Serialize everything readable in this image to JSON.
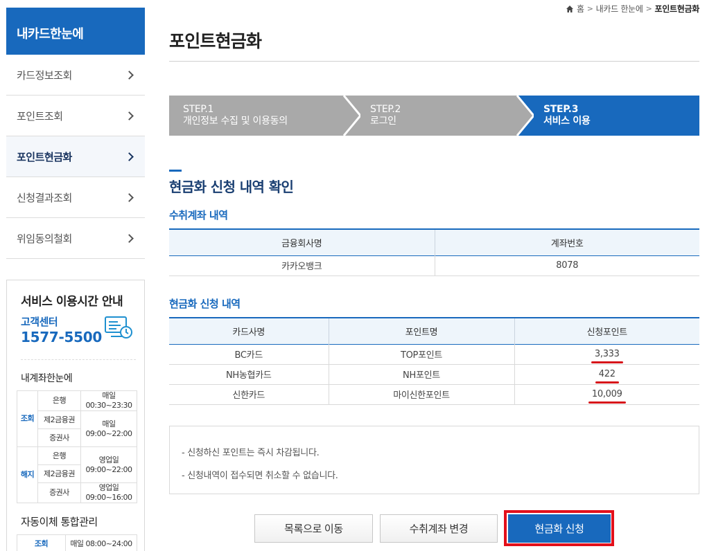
{
  "breadcrumb": {
    "home": "홈",
    "parent": "내카드 한눈에",
    "current": "포인트현금화"
  },
  "sidebar": {
    "title": "내카드한눈에",
    "items": [
      {
        "label": "카드정보조회"
      },
      {
        "label": "포인트조회"
      },
      {
        "label": "포인트현금화"
      },
      {
        "label": "신청결과조회"
      },
      {
        "label": "위임동의철회"
      }
    ],
    "service": {
      "title": "서비스 이용시간 안내",
      "cc_label": "고객센터",
      "cc_phone": "1577-5500",
      "section1": "내계좌한눈에",
      "rows": {
        "inquiry": "조회",
        "cancel": "해지",
        "bank": "은행",
        "second": "제2금융권",
        "securities": "증권사",
        "daily": "매일",
        "t1": "00:30~23:30",
        "t2": "09:00~22:00",
        "biz": "영업일",
        "t3": "09:00~22:00",
        "t4": "09:00~16:00"
      },
      "section2": "자동이체 통합관리",
      "row2_cat": "조회",
      "row2_time": "매일 08:00~24:00"
    }
  },
  "page": {
    "title": "포인트현금화"
  },
  "steps": [
    {
      "num": "STEP.1",
      "label": "개인정보 수집 및 이용동의"
    },
    {
      "num": "STEP.2",
      "label": "로그인"
    },
    {
      "num": "STEP.3",
      "label": "서비스 이용"
    }
  ],
  "section": {
    "title": "현금화 신청 내역 확인",
    "account_title": "수취계좌 내역",
    "account_headers": [
      "금융회사명",
      "계좌번호"
    ],
    "account_row": [
      "카카오뱅크",
      "8078"
    ],
    "request_title": "현금화 신청 내역",
    "request_headers": [
      "카드사명",
      "포인트명",
      "신청포인트"
    ],
    "request_rows": [
      [
        "BC카드",
        "TOP포인트",
        "3,333"
      ],
      [
        "NH농협카드",
        "NH포인트",
        "422"
      ],
      [
        "신한카드",
        "마이신한포인트",
        "10,009"
      ]
    ]
  },
  "notice": [
    "- 신청하신 포인트는 즉시 차감됩니다.",
    "- 신청내역이 접수되면 취소할 수 없습니다."
  ],
  "buttons": {
    "list": "목록으로 이동",
    "change": "수취계좌 변경",
    "apply": "현금화 신청"
  },
  "colors": {
    "primary": "#1869bd",
    "step_inactive": "#a9a9a9",
    "highlight": "#e3101b"
  }
}
